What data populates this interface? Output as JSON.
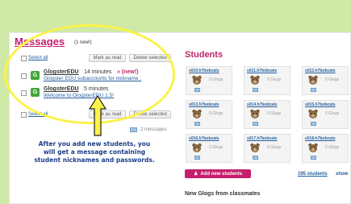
{
  "messages": {
    "title": "Messages",
    "new_count": "(1 new!)",
    "select_all": "Select all",
    "mark_as_read": "Mark as read",
    "delete_selected": "Delete selected",
    "count_text": "2 messages",
    "items": [
      {
        "sender": "GlogsterEDU",
        "time": "14 minutes",
        "new_flag": "» (new!)",
        "subject": "Glogster EDU subaccounts for nickname :"
      },
      {
        "sender": "GlogsterEDU",
        "time": "5 minutes",
        "new_flag": "",
        "subject": "Welcome to GlogsterEDU 1.5!"
      }
    ]
  },
  "annotation": "After you add new students, you will get a message containing student nicknames and passwords.",
  "students": {
    "title": "Students",
    "cards": [
      {
        "name": "s010.h7bobcats",
        "glogs": "0 Glogs"
      },
      {
        "name": "s011.h7bobcats",
        "glogs": "0 Glogs"
      },
      {
        "name": "s012.h7bobcats",
        "glogs": "0 Glogs"
      },
      {
        "name": "s013.h7bobcats",
        "glogs": "0 Glogs"
      },
      {
        "name": "s014.h7bobcats",
        "glogs": "0 Glogs"
      },
      {
        "name": "s015.h7bobcats",
        "glogs": "0 Glogs"
      },
      {
        "name": "s016.h7bobcats",
        "glogs": "0 Glogs"
      },
      {
        "name": "s017.h7bobcats",
        "glogs": "0 Glogs"
      },
      {
        "name": "s018.h7bobcats",
        "glogs": "0 Glogs"
      }
    ],
    "add_button": "Add new students",
    "count_link": "195 students",
    "show_link": "show"
  },
  "new_glogs_title": "New Glogs from classmates",
  "colors": {
    "accent": "#c51f6e",
    "link": "#245f9e",
    "highlight": "#fbf24a",
    "background": "#cfe9a6"
  }
}
